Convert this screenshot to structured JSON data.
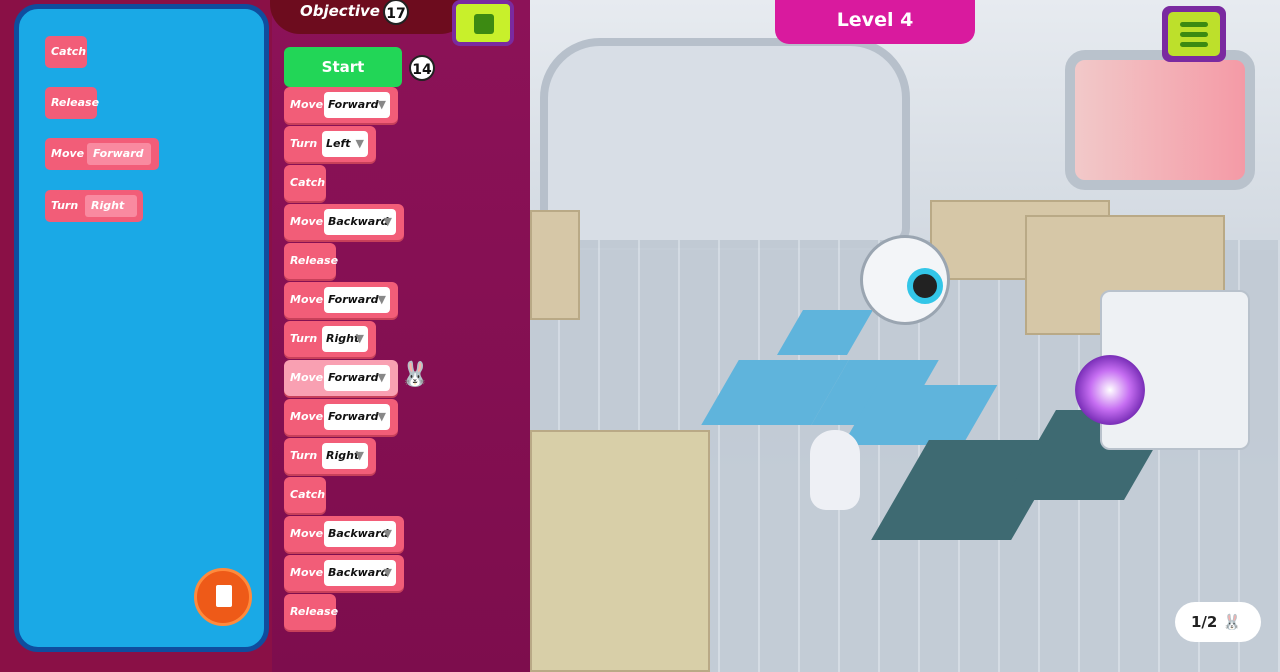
{
  "header": {
    "objective_label": "Objective :",
    "objective_value": "17",
    "level": "Level 4",
    "stop_button": "stop-icon",
    "menu_button": "menu-icon"
  },
  "palette": {
    "blocks": [
      {
        "label": "Catch"
      },
      {
        "label": "Release"
      },
      {
        "label": "Move",
        "value": "Forward"
      },
      {
        "label": "Turn",
        "value": "Right"
      }
    ],
    "trash": "trash-icon"
  },
  "program": {
    "start_label": "Start",
    "block_count": "14",
    "blocks": [
      {
        "label": "Move",
        "value": "Forward"
      },
      {
        "label": "Turn",
        "value": "Left"
      },
      {
        "label": "Catch"
      },
      {
        "label": "Move",
        "value": "Backward"
      },
      {
        "label": "Release"
      },
      {
        "label": "Move",
        "value": "Forward"
      },
      {
        "label": "Turn",
        "value": "Right"
      },
      {
        "label": "Move",
        "value": "Forward",
        "active": true
      },
      {
        "label": "Move",
        "value": "Forward"
      },
      {
        "label": "Turn",
        "value": "Right"
      },
      {
        "label": "Catch"
      },
      {
        "label": "Move",
        "value": "Backward"
      },
      {
        "label": "Move",
        "value": "Backward"
      },
      {
        "label": "Release"
      }
    ]
  },
  "hud": {
    "rabbit_counter": "1/2"
  },
  "colors": {
    "start": "#22d657",
    "block": "#f25d78",
    "palette_bg": "#1aa9e6",
    "level_banner": "#d91a9e",
    "menu": "#bde02b"
  }
}
